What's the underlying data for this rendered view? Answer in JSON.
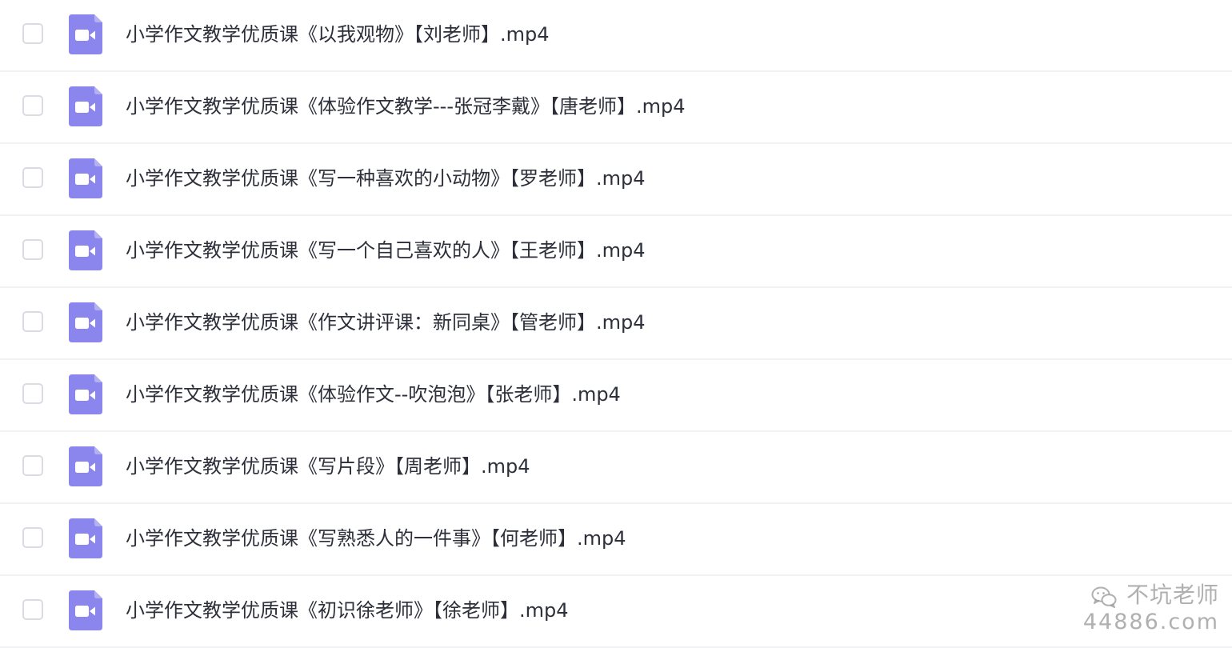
{
  "files": [
    {
      "name": "小学作文教学优质课《以我观物》【刘老师】.mp4",
      "icon": "video-file-icon",
      "checked": false
    },
    {
      "name": "小学作文教学优质课《体验作文教学---张冠李戴》【唐老师】.mp4",
      "icon": "video-file-icon",
      "checked": false
    },
    {
      "name": "小学作文教学优质课《写一种喜欢的小动物》【罗老师】.mp4",
      "icon": "video-file-icon",
      "checked": false
    },
    {
      "name": "小学作文教学优质课《写一个自己喜欢的人》【王老师】.mp4",
      "icon": "video-file-icon",
      "checked": false
    },
    {
      "name": "小学作文教学优质课《作文讲评课：新同桌》【管老师】.mp4",
      "icon": "video-file-icon",
      "checked": false
    },
    {
      "name": "小学作文教学优质课《体验作文--吹泡泡》【张老师】.mp4",
      "icon": "video-file-icon",
      "checked": false
    },
    {
      "name": "小学作文教学优质课《写片段》【周老师】.mp4",
      "icon": "video-file-icon",
      "checked": false
    },
    {
      "name": "小学作文教学优质课《写熟悉人的一件事》【何老师】.mp4",
      "icon": "video-file-icon",
      "checked": false
    },
    {
      "name": "小学作文教学优质课《初识徐老师》【徐老师】.mp4",
      "icon": "video-file-icon",
      "checked": false
    }
  ],
  "watermark": {
    "name": "不坑老师",
    "domain": "44886.com",
    "icon": "wechat-icon"
  },
  "colors": {
    "icon_fill": "#8a86ee",
    "text": "#2d2f3a",
    "divider": "#f1f2f6",
    "checkbox_border": "#dadce3"
  }
}
